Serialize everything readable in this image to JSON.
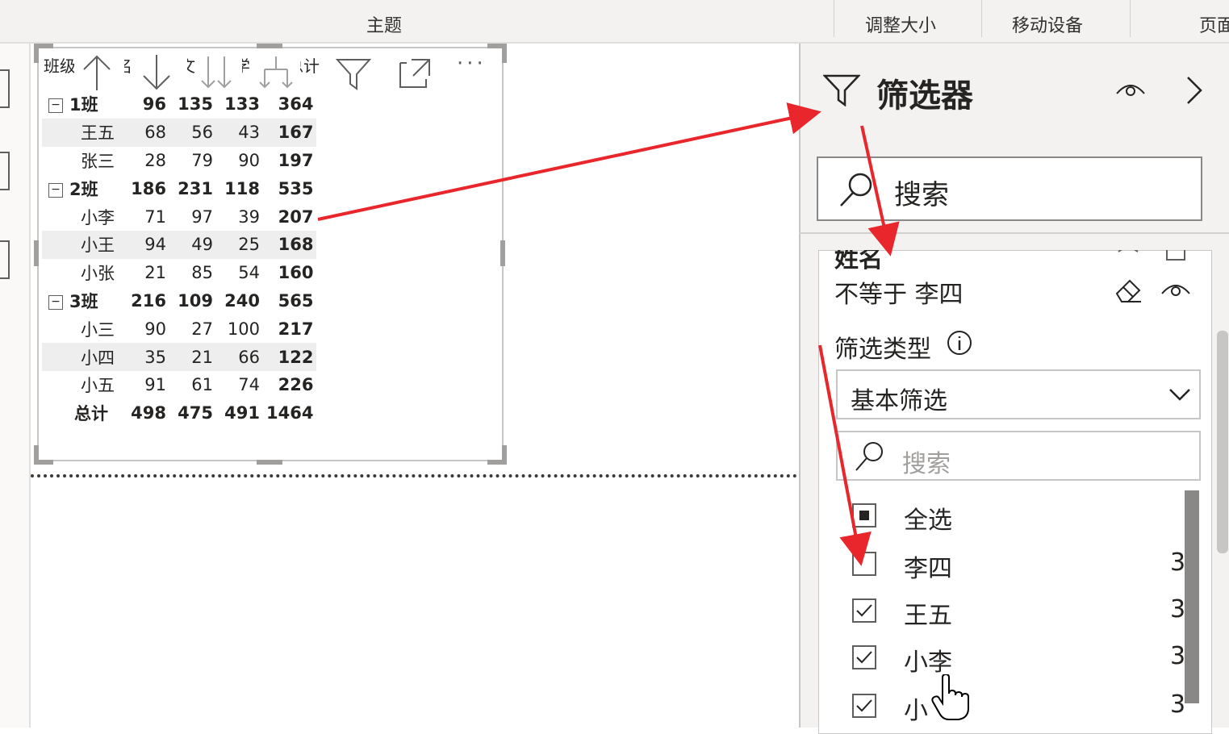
{
  "ribbon": {
    "groups": [
      "主题",
      "调整大小",
      "移动设备",
      "页面"
    ]
  },
  "visual": {
    "header_labels": [
      "班级",
      "姓名",
      "语文",
      "数学",
      "英语",
      "总计"
    ],
    "icons": [
      "sort-ascending-icon",
      "sort-descending-icon",
      "drill-down-icon",
      "expand-hierarchy-icon",
      "filter-icon",
      "focus-mode-icon",
      "more-options-icon"
    ],
    "rows": [
      {
        "label": "1班",
        "type": "group",
        "v1": "96",
        "v2": "135",
        "v3": "133",
        "total": "364"
      },
      {
        "label": "王五",
        "type": "detail",
        "v1": "68",
        "v2": "56",
        "v3": "43",
        "total": "167"
      },
      {
        "label": "张三",
        "type": "detail",
        "v1": "28",
        "v2": "79",
        "v3": "90",
        "total": "197"
      },
      {
        "label": "2班",
        "type": "group",
        "v1": "186",
        "v2": "231",
        "v3": "118",
        "total": "535"
      },
      {
        "label": "小李",
        "type": "detail",
        "v1": "71",
        "v2": "97",
        "v3": "39",
        "total": "207"
      },
      {
        "label": "小王",
        "type": "detail",
        "v1": "94",
        "v2": "49",
        "v3": "25",
        "total": "168"
      },
      {
        "label": "小张",
        "type": "detail",
        "v1": "21",
        "v2": "85",
        "v3": "54",
        "total": "160"
      },
      {
        "label": "3班",
        "type": "group",
        "v1": "216",
        "v2": "109",
        "v3": "240",
        "total": "565"
      },
      {
        "label": "小三",
        "type": "detail",
        "v1": "90",
        "v2": "27",
        "v3": "100",
        "total": "217"
      },
      {
        "label": "小四",
        "type": "detail",
        "v1": "35",
        "v2": "21",
        "v3": "66",
        "total": "122"
      },
      {
        "label": "小五",
        "type": "detail",
        "v1": "91",
        "v2": "61",
        "v3": "74",
        "total": "226"
      },
      {
        "label": "总计",
        "type": "grand",
        "v1": "498",
        "v2": "475",
        "v3": "491",
        "total": "1464"
      }
    ]
  },
  "filter_pane": {
    "title": "筛选器",
    "search_placeholder": "搜索",
    "card_title": "姓名",
    "condition": "不等于 李四",
    "filter_type_label": "筛选类型",
    "filter_type_value": "基本筛选",
    "list_search_placeholder": "搜索",
    "items": [
      {
        "label": "全选",
        "state": "partial",
        "count": ""
      },
      {
        "label": "李四",
        "state": "unchecked",
        "count": "3"
      },
      {
        "label": "王五",
        "state": "checked",
        "count": "3"
      },
      {
        "label": "小李",
        "state": "checked",
        "count": "3"
      },
      {
        "label": "小",
        "state": "checked",
        "count": "3"
      }
    ]
  },
  "colors": {
    "arrow": "#e8262b",
    "pane_bg": "#f3f2f1",
    "alt_row": "#eeeeee"
  }
}
